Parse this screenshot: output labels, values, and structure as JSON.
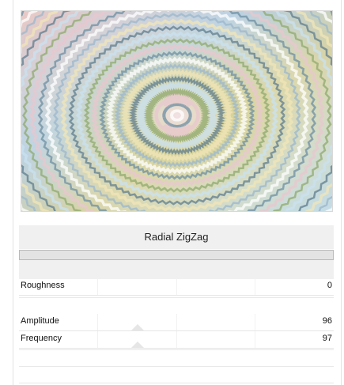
{
  "dialog": {
    "title": "Radial ZigZag",
    "progress_fraction": 0
  },
  "preview": {
    "description_icon": "radial-zigzag-preview-image"
  },
  "params": [
    {
      "label": "Roughness",
      "value": "0"
    },
    {
      "label": "Amplitude",
      "value": "96"
    },
    {
      "label": "Frequency",
      "value": "97"
    }
  ],
  "colors": {
    "panel_bg": "#f0f0f0",
    "progress_fill": "#7fb9e8",
    "border": "#b9b9b9"
  }
}
